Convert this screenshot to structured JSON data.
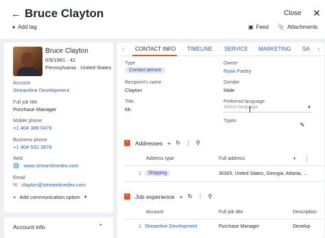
{
  "header": {
    "back_icon": "arrow-left-icon",
    "title": "Bruce Clayton",
    "close_label": "Close",
    "close_icon": "x-icon",
    "add_tag_label": "Add tag",
    "feed_label": "Feed",
    "attachments_label": "Attachments"
  },
  "profile": {
    "name": "Bruce Clayton",
    "dob_age": "6/9/1981 · 42",
    "location": "Pennsylvania · United States",
    "fields": {
      "account_label": "Account",
      "account_value": "Streamline Development",
      "job_title_label": "Full job title",
      "job_title_value": "Purchase Manager",
      "mobile_label": "Mobile phone",
      "mobile_value": "+1 404 389 0476",
      "business_label": "Business phone",
      "business_value": "+1 404 532 3976",
      "web_label": "Web",
      "web_value": "www.streamlinedev.com",
      "email_label": "Email",
      "email_value": "clayton@streamlinedev.com"
    },
    "add_communication_label": "Add communication option",
    "account_info_label": "Account info"
  },
  "tabs": [
    "CONTACT INFO",
    "TIMELINE",
    "SERVICE",
    "MARKETING",
    "SA"
  ],
  "contact_info": {
    "type_label": "Type",
    "type_value": "Contact person",
    "owner_label": "Owner",
    "owner_value": "Ryan Farley",
    "recipient_label": "Recipient's name",
    "recipient_value": "Clayton",
    "gender_label": "Gender",
    "gender_value": "Male",
    "title_label": "Title",
    "title_value": "Mr.",
    "language_label": "Preferred language",
    "language_placeholder": "Select language",
    "types_label": "Types"
  },
  "addresses": {
    "title": "Addresses",
    "col1": "Address type",
    "col2": "Full address",
    "row_num": "1",
    "row_type": "Shipping",
    "row_address": "30305, United States, Georgia, Atlanta, ..."
  },
  "job_experience": {
    "title": "Job experience",
    "col1": "Account",
    "col2": "Full job title",
    "col3": "Description",
    "row_num": "1",
    "row_account": "Streamline Development",
    "row_job": "Purchase Manager",
    "row_desc": "Develop"
  },
  "colors": {
    "accent": "#e8532f",
    "link": "#1f5fbf",
    "pill_bg": "#e4e7f7"
  }
}
